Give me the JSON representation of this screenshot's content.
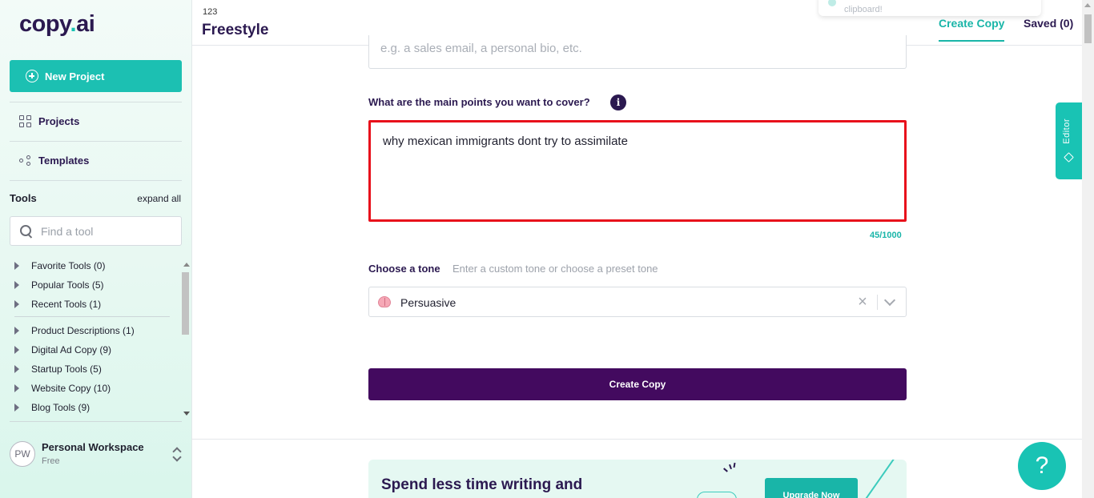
{
  "app": {
    "logo_main": "copy",
    "logo_dot": ".",
    "logo_suffix": "ai"
  },
  "sidebar": {
    "new_project_label": "New Project",
    "nav": [
      {
        "label": "Projects",
        "icon": "grid-icon"
      },
      {
        "label": "Templates",
        "icon": "templates-icon"
      }
    ],
    "tools_title": "Tools",
    "expand_all": "expand all",
    "search_placeholder": "Find a tool",
    "tool_groups": [
      "Favorite Tools (0)",
      "Popular Tools (5)",
      "Recent Tools (1)",
      "Product Descriptions (1)",
      "Digital Ad Copy (9)",
      "Startup Tools (5)",
      "Website Copy (10)",
      "Blog Tools (9)"
    ],
    "workspace": {
      "initials": "PW",
      "name": "Personal Workspace",
      "plan": "Free"
    }
  },
  "header": {
    "project_number": "123",
    "project_title": "Freestyle",
    "toast_text": "clipboard!",
    "tabs": {
      "create": "Create Copy",
      "saved": "Saved (0)"
    }
  },
  "form": {
    "prev_placeholder": "e.g. a sales email, a personal bio, etc.",
    "main_points_label": "What are the main points you want to cover?",
    "info_glyph": "i",
    "main_points_value": "why mexican immigrants dont try to assimilate",
    "char_counter": "45/1000",
    "tone_label": "Choose a tone",
    "tone_hint": "Enter a custom tone or choose a preset tone",
    "tone_value": "Persuasive",
    "clear_glyph": "×",
    "create_button": "Create Copy"
  },
  "promo": {
    "headline": "Spend less time writing and",
    "button": "Upgrade Now"
  },
  "editor_tab": {
    "label": "Editor"
  },
  "help": {
    "glyph": "?"
  },
  "colors": {
    "accent": "#19c3b4",
    "brand_dark": "#430a5f",
    "title": "#2b1950",
    "highlight_border": "#e8101b"
  }
}
